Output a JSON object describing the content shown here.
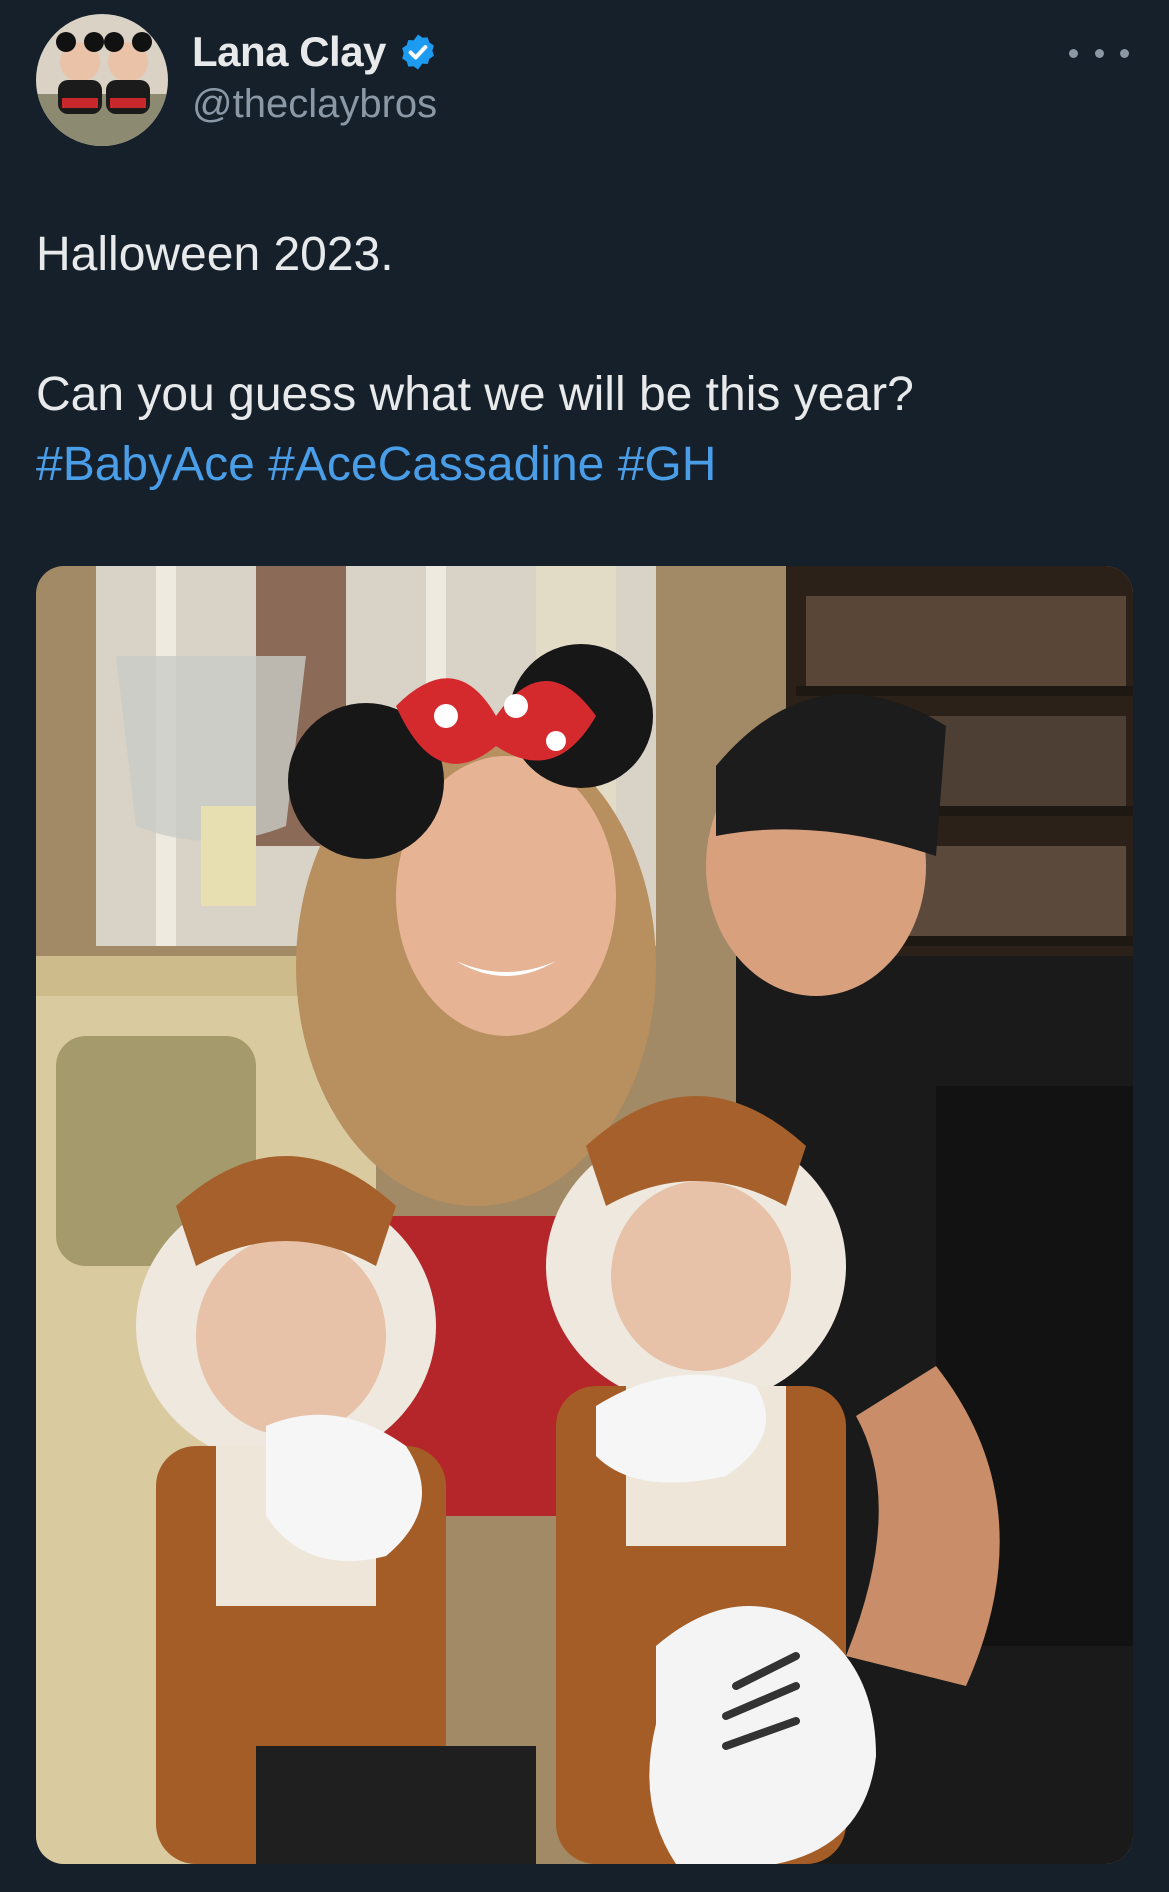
{
  "author": {
    "display_name": "Lana Clay",
    "handle": "@theclaybros",
    "verified": true,
    "avatar_icon": "avatar-photo-icon"
  },
  "menu": {
    "icon": "more-options-icon"
  },
  "tweet": {
    "line1": "Halloween 2023.",
    "line2": "Can you guess what we will be this year?",
    "hashtags": [
      "#BabyAce",
      "#AceCassadine",
      "#GH"
    ]
  },
  "media": {
    "icon": "photo-icon"
  },
  "colors": {
    "background": "#15202b",
    "text": "#e7e9ea",
    "secondary_text": "#8b98a5",
    "link": "#4a9ee8",
    "verified_badge": "#1d9bf0"
  }
}
